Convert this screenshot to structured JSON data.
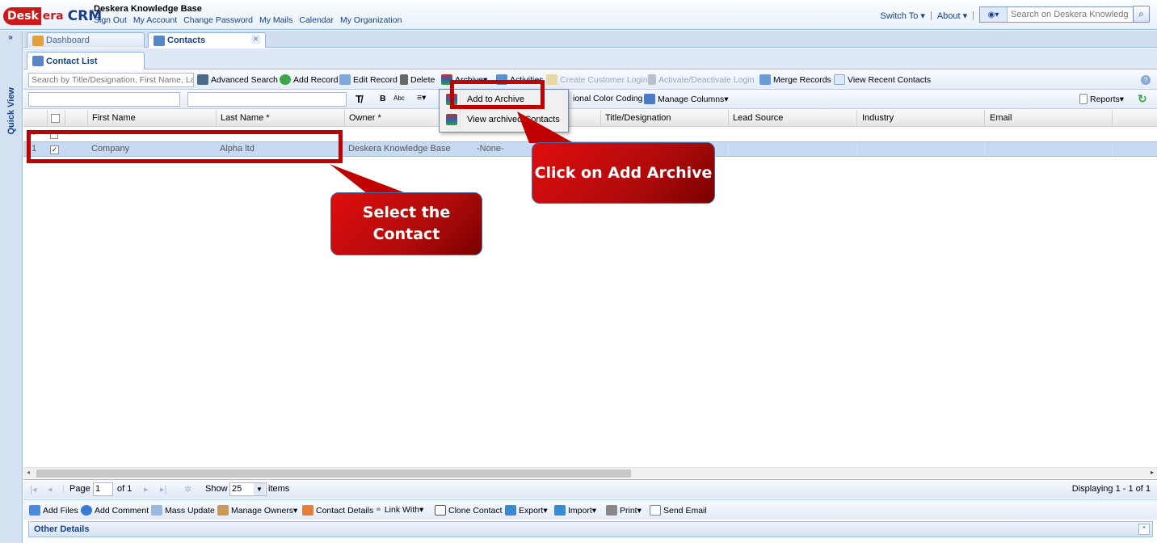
{
  "header": {
    "brand_desk": "Desk",
    "brand_era": "era",
    "brand_crm": "CRM",
    "title": "Deskera Knowledge Base",
    "links": [
      "Sign Out",
      "My Account",
      "Change Password",
      "My Mails",
      "Calendar",
      "My Organization"
    ],
    "switch_to": "Switch To",
    "about": "About",
    "search_placeholder": "Search on Deskera Knowledg"
  },
  "sidebar": {
    "quick_view": "Quick View"
  },
  "tabs": {
    "dashboard": "Dashboard",
    "contacts": "Contacts",
    "contact_list": "Contact List"
  },
  "toolbar": {
    "search_placeholder": "Search by Title/Designation, First Name, La",
    "advanced_search": "Advanced Search",
    "add_record": "Add Record",
    "edit_record": "Edit Record",
    "delete": "Delete",
    "archive": "Archive",
    "activities": "Activities",
    "create_customer_login": "Create Customer Login",
    "activate_deactivate_login": "Activate/Deactivate Login",
    "merge_records": "Merge Records",
    "view_recent_contacts": "View Recent Contacts",
    "conditional_color_coding": "ional Color Coding",
    "manage_columns": "Manage Columns",
    "reports": "Reports"
  },
  "archive_menu": {
    "add_to_archive": "Add to Archive",
    "view_archived": "View archived Contacts"
  },
  "grid": {
    "columns": [
      "First Name",
      "Last Name *",
      "Owner *",
      "",
      "Title/Designation",
      "Lead Source",
      "Industry",
      "Email"
    ],
    "rows": [
      {
        "num": "1",
        "first_name": "Company",
        "last_name": "Alpha ltd",
        "owner": "Deskera Knowledge Base",
        "col4": "-None-"
      }
    ]
  },
  "paging": {
    "page_label": "Page",
    "page": "1",
    "of": "of 1",
    "show": "Show",
    "page_size": "25",
    "items": "items",
    "display": "Displaying 1 - 1 of 1"
  },
  "bottom_toolbar": [
    "Add Files",
    "Add Comment",
    "Mass Update",
    "Manage Owners",
    "Contact Details",
    "Link With",
    "Clone Contact",
    "Export",
    "Import",
    "Print",
    "Send Email"
  ],
  "other_details": "Other Details",
  "annotations": {
    "callout_archive": "Click on Add Archive",
    "callout_select_1": "Select the",
    "callout_select_2": "Contact"
  },
  "colors": {
    "annotation_red": "#c00000",
    "brand_red": "#cc1a1a",
    "ui_blue": "#15428b"
  }
}
